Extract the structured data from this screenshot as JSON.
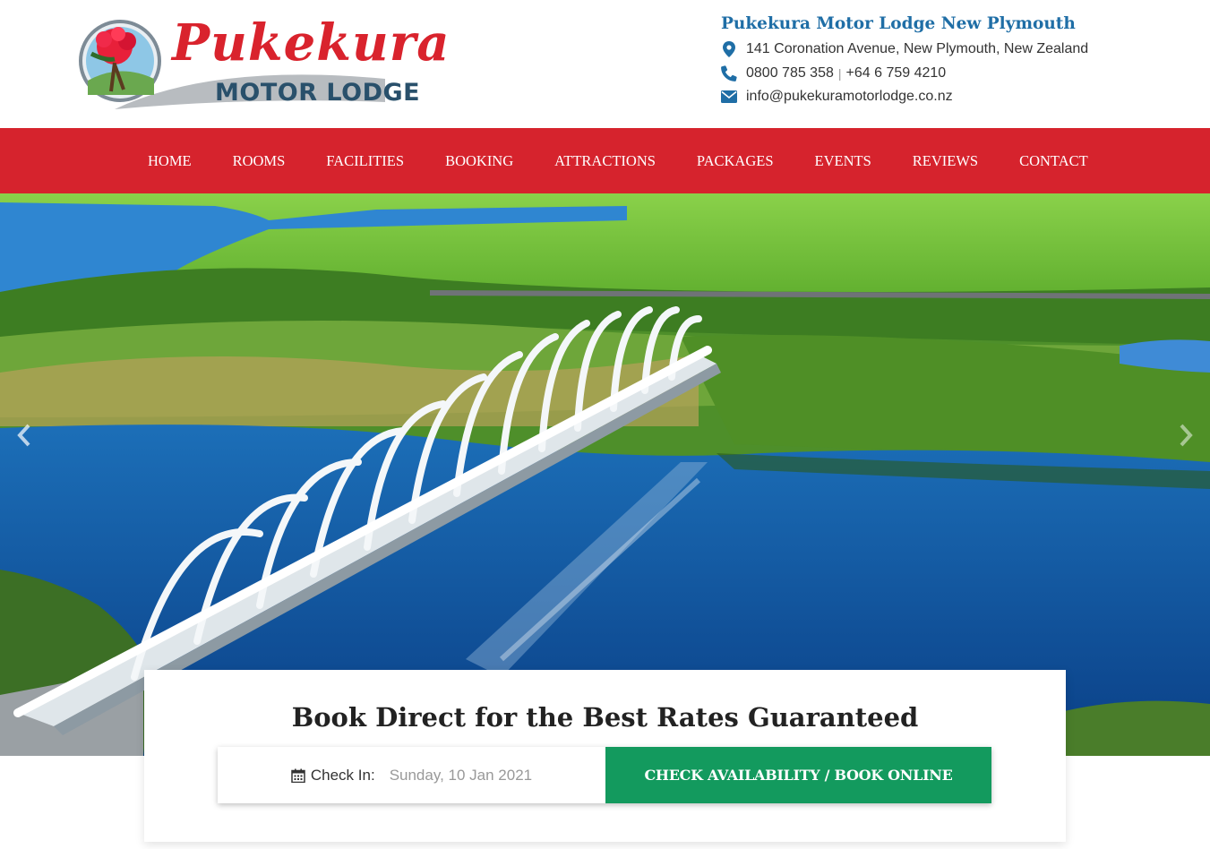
{
  "brand": {
    "logo_word1": "Pukekura",
    "logo_word2": "MOTOR LODGE"
  },
  "contact": {
    "title": "Pukekura Motor Lodge New Plymouth",
    "address": "141 Coronation Avenue, New Plymouth, New Zealand",
    "phone1": "0800 785 358",
    "phone_separator": "|",
    "phone2": "+64 6 759 4210",
    "email": "info@pukekuramotorlodge.co.nz",
    "icons": {
      "address": "map-marker-icon",
      "phone": "phone-icon",
      "email": "envelope-icon"
    }
  },
  "nav": {
    "items": [
      {
        "label": "HOME"
      },
      {
        "label": "ROOMS"
      },
      {
        "label": "FACILITIES"
      },
      {
        "label": "BOOKING"
      },
      {
        "label": "ATTRACTIONS"
      },
      {
        "label": "PACKAGES"
      },
      {
        "label": "EVENTS"
      },
      {
        "label": "REVIEWS"
      },
      {
        "label": "CONTACT"
      }
    ]
  },
  "hero": {
    "prev_icon": "chevron-left-icon",
    "next_icon": "chevron-right-icon"
  },
  "booking": {
    "title": "Book Direct for the Best Rates Guaranteed",
    "checkin_label": "Check In:",
    "checkin_value": "Sunday, 10 Jan 2021",
    "button_label": "CHECK AVAILABILITY / BOOK ONLINE"
  },
  "colors": {
    "nav_bg": "#d6232d",
    "brand_red": "#d9232d",
    "brand_navy": "#29506b",
    "contact_blue": "#1f6ea6",
    "button_green": "#139a5e"
  }
}
